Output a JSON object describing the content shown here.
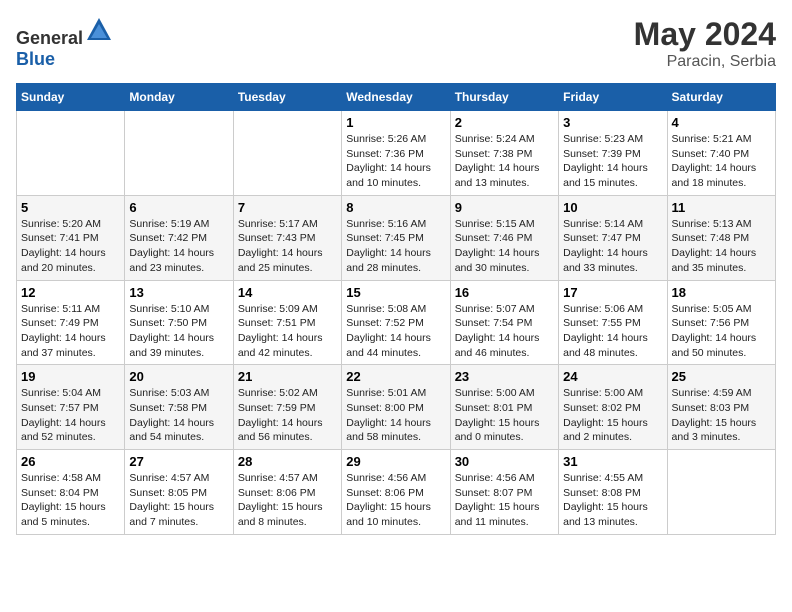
{
  "header": {
    "logo": {
      "text_general": "General",
      "text_blue": "Blue"
    },
    "month": "May 2024",
    "location": "Paracin, Serbia"
  },
  "weekdays": [
    "Sunday",
    "Monday",
    "Tuesday",
    "Wednesday",
    "Thursday",
    "Friday",
    "Saturday"
  ],
  "weeks": [
    [
      {
        "day": "",
        "info": ""
      },
      {
        "day": "",
        "info": ""
      },
      {
        "day": "",
        "info": ""
      },
      {
        "day": "1",
        "info": "Sunrise: 5:26 AM\nSunset: 7:36 PM\nDaylight: 14 hours\nand 10 minutes."
      },
      {
        "day": "2",
        "info": "Sunrise: 5:24 AM\nSunset: 7:38 PM\nDaylight: 14 hours\nand 13 minutes."
      },
      {
        "day": "3",
        "info": "Sunrise: 5:23 AM\nSunset: 7:39 PM\nDaylight: 14 hours\nand 15 minutes."
      },
      {
        "day": "4",
        "info": "Sunrise: 5:21 AM\nSunset: 7:40 PM\nDaylight: 14 hours\nand 18 minutes."
      }
    ],
    [
      {
        "day": "5",
        "info": "Sunrise: 5:20 AM\nSunset: 7:41 PM\nDaylight: 14 hours\nand 20 minutes."
      },
      {
        "day": "6",
        "info": "Sunrise: 5:19 AM\nSunset: 7:42 PM\nDaylight: 14 hours\nand 23 minutes."
      },
      {
        "day": "7",
        "info": "Sunrise: 5:17 AM\nSunset: 7:43 PM\nDaylight: 14 hours\nand 25 minutes."
      },
      {
        "day": "8",
        "info": "Sunrise: 5:16 AM\nSunset: 7:45 PM\nDaylight: 14 hours\nand 28 minutes."
      },
      {
        "day": "9",
        "info": "Sunrise: 5:15 AM\nSunset: 7:46 PM\nDaylight: 14 hours\nand 30 minutes."
      },
      {
        "day": "10",
        "info": "Sunrise: 5:14 AM\nSunset: 7:47 PM\nDaylight: 14 hours\nand 33 minutes."
      },
      {
        "day": "11",
        "info": "Sunrise: 5:13 AM\nSunset: 7:48 PM\nDaylight: 14 hours\nand 35 minutes."
      }
    ],
    [
      {
        "day": "12",
        "info": "Sunrise: 5:11 AM\nSunset: 7:49 PM\nDaylight: 14 hours\nand 37 minutes."
      },
      {
        "day": "13",
        "info": "Sunrise: 5:10 AM\nSunset: 7:50 PM\nDaylight: 14 hours\nand 39 minutes."
      },
      {
        "day": "14",
        "info": "Sunrise: 5:09 AM\nSunset: 7:51 PM\nDaylight: 14 hours\nand 42 minutes."
      },
      {
        "day": "15",
        "info": "Sunrise: 5:08 AM\nSunset: 7:52 PM\nDaylight: 14 hours\nand 44 minutes."
      },
      {
        "day": "16",
        "info": "Sunrise: 5:07 AM\nSunset: 7:54 PM\nDaylight: 14 hours\nand 46 minutes."
      },
      {
        "day": "17",
        "info": "Sunrise: 5:06 AM\nSunset: 7:55 PM\nDaylight: 14 hours\nand 48 minutes."
      },
      {
        "day": "18",
        "info": "Sunrise: 5:05 AM\nSunset: 7:56 PM\nDaylight: 14 hours\nand 50 minutes."
      }
    ],
    [
      {
        "day": "19",
        "info": "Sunrise: 5:04 AM\nSunset: 7:57 PM\nDaylight: 14 hours\nand 52 minutes."
      },
      {
        "day": "20",
        "info": "Sunrise: 5:03 AM\nSunset: 7:58 PM\nDaylight: 14 hours\nand 54 minutes."
      },
      {
        "day": "21",
        "info": "Sunrise: 5:02 AM\nSunset: 7:59 PM\nDaylight: 14 hours\nand 56 minutes."
      },
      {
        "day": "22",
        "info": "Sunrise: 5:01 AM\nSunset: 8:00 PM\nDaylight: 14 hours\nand 58 minutes."
      },
      {
        "day": "23",
        "info": "Sunrise: 5:00 AM\nSunset: 8:01 PM\nDaylight: 15 hours\nand 0 minutes."
      },
      {
        "day": "24",
        "info": "Sunrise: 5:00 AM\nSunset: 8:02 PM\nDaylight: 15 hours\nand 2 minutes."
      },
      {
        "day": "25",
        "info": "Sunrise: 4:59 AM\nSunset: 8:03 PM\nDaylight: 15 hours\nand 3 minutes."
      }
    ],
    [
      {
        "day": "26",
        "info": "Sunrise: 4:58 AM\nSunset: 8:04 PM\nDaylight: 15 hours\nand 5 minutes."
      },
      {
        "day": "27",
        "info": "Sunrise: 4:57 AM\nSunset: 8:05 PM\nDaylight: 15 hours\nand 7 minutes."
      },
      {
        "day": "28",
        "info": "Sunrise: 4:57 AM\nSunset: 8:06 PM\nDaylight: 15 hours\nand 8 minutes."
      },
      {
        "day": "29",
        "info": "Sunrise: 4:56 AM\nSunset: 8:06 PM\nDaylight: 15 hours\nand 10 minutes."
      },
      {
        "day": "30",
        "info": "Sunrise: 4:56 AM\nSunset: 8:07 PM\nDaylight: 15 hours\nand 11 minutes."
      },
      {
        "day": "31",
        "info": "Sunrise: 4:55 AM\nSunset: 8:08 PM\nDaylight: 15 hours\nand 13 minutes."
      },
      {
        "day": "",
        "info": ""
      }
    ]
  ]
}
